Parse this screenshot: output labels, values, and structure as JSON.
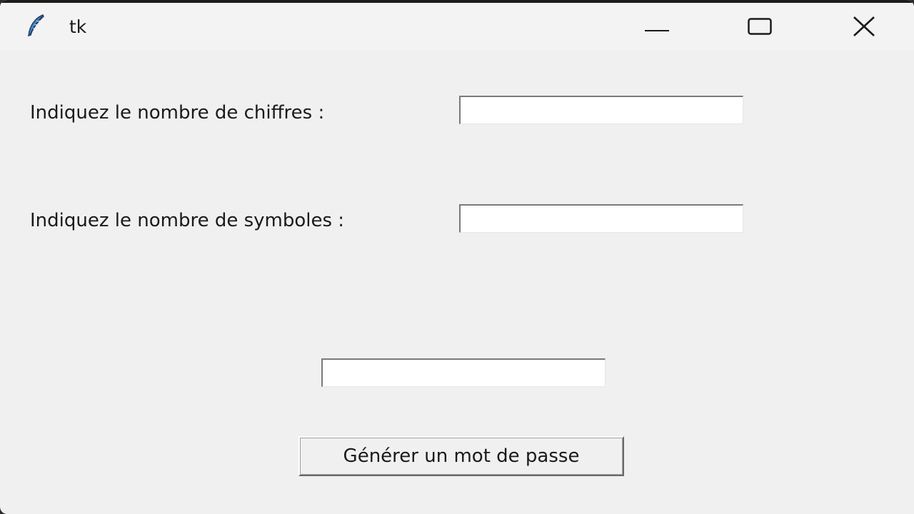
{
  "window": {
    "title": "tk",
    "controls": {
      "minimize": "minimize-icon",
      "maximize": "maximize-icon",
      "close": "close-icon"
    }
  },
  "form": {
    "digits_label": "Indiquez le nombre de chiffres :",
    "digits_value": "",
    "symbols_label": "Indiquez le nombre de symboles :",
    "symbols_value": "",
    "password_output": "",
    "generate_label": "Générer un mot de passe"
  },
  "colors": {
    "background": "#f0f0f0",
    "titlebar": "#f3f3f3",
    "entry_bg": "#ffffff"
  }
}
